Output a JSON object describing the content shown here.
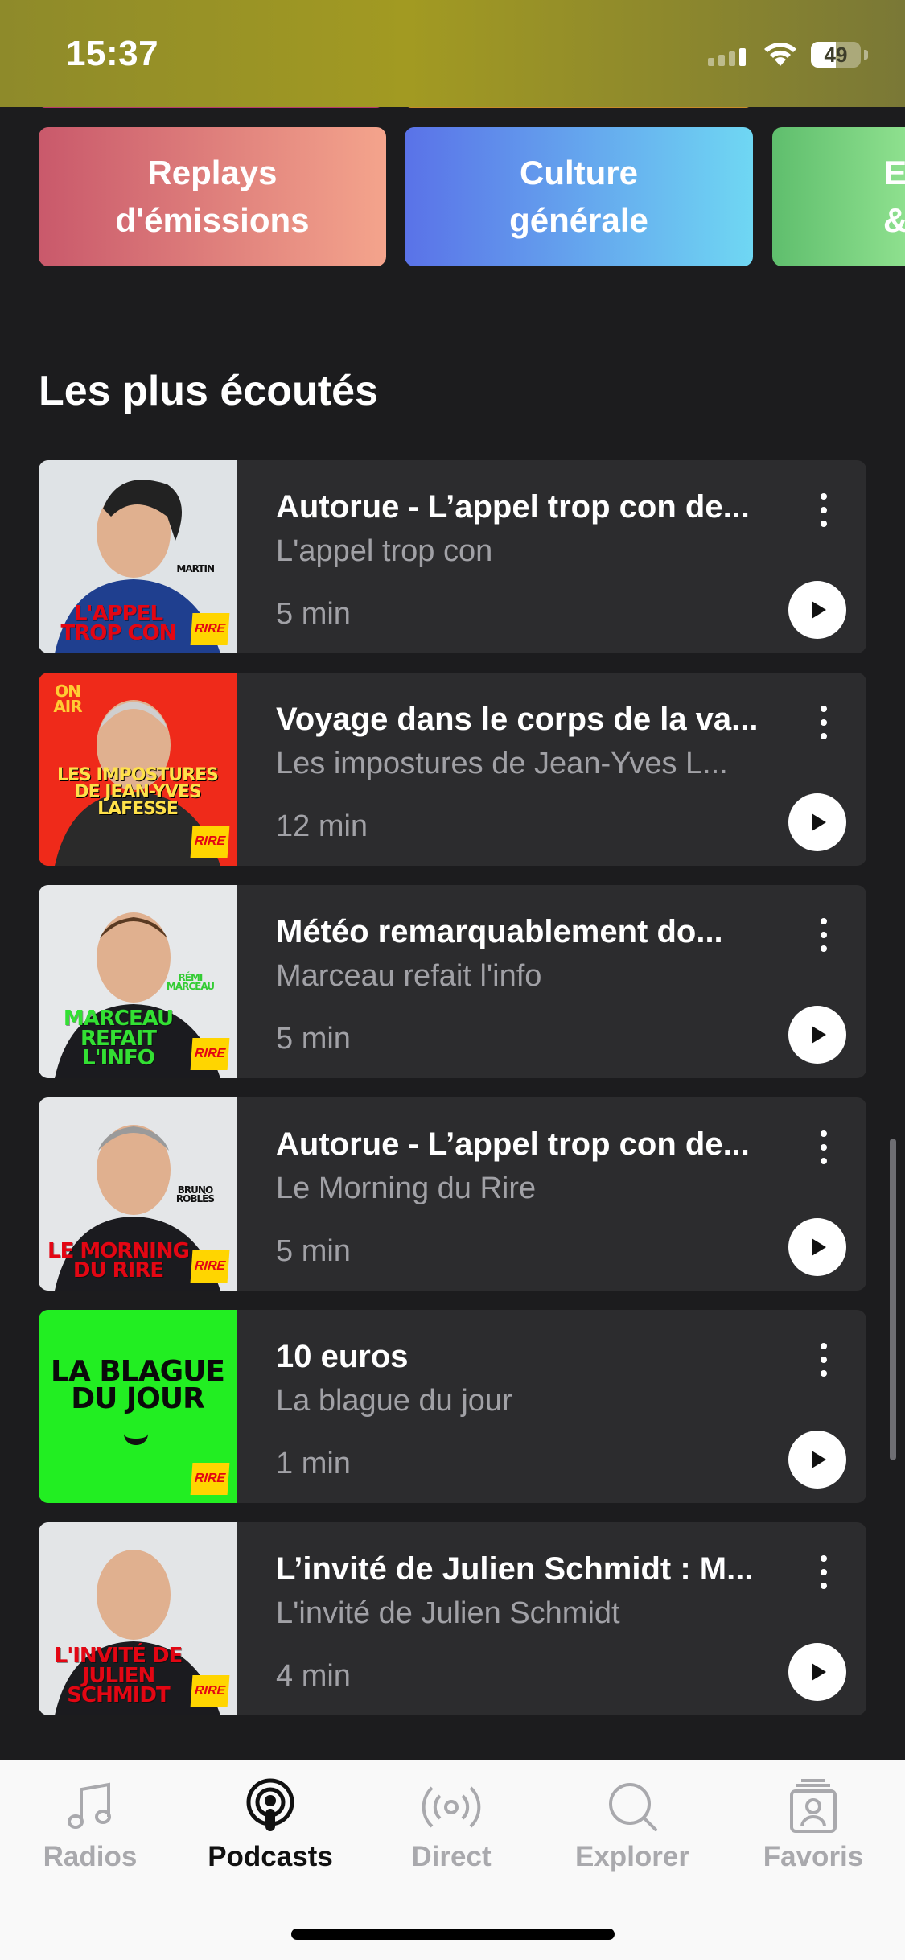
{
  "status_bar": {
    "time": "15:37",
    "battery": "49"
  },
  "categories": [
    {
      "label": "Replays\nd'émissions",
      "gradient": [
        "#c9596b",
        "#f4a48c"
      ]
    },
    {
      "label": "Culture\ngénérale",
      "gradient": [
        "#5a72e8",
        "#6fd7f3"
      ]
    },
    {
      "label": "E\n&",
      "gradient": [
        "#5fbe6d",
        "#8ee08e"
      ]
    }
  ],
  "section_title": "Les plus écoutés",
  "podcasts": [
    {
      "title": "Autorue - L’appel trop con de...",
      "show": "L'appel trop con",
      "duration": "5 min",
      "thumb_text": "L'APPEL\nTROP CON",
      "thumb_small": "MARTIN",
      "thumb_bg": "#dfe3e6",
      "thumb_text_color": "#e30613"
    },
    {
      "title": "Voyage dans le corps de la va...",
      "show": "Les impostures de Jean-Yves L...",
      "duration": "12 min",
      "thumb_text": "LES IMPOSTURES\nDE JEAN-YVES\nLAFESSE",
      "thumb_small": "ON AIR",
      "thumb_bg": "#ef2a1a",
      "thumb_text_color": "#ffe14a"
    },
    {
      "title": "Météo remarquablement do...",
      "show": "Marceau refait l'info",
      "duration": "5 min",
      "thumb_text": "MARCEAU\nREFAIT L'INFO",
      "thumb_small": "RÉMI\nMARCEAU",
      "thumb_bg": "#e6e8ea",
      "thumb_text_color": "#33e033"
    },
    {
      "title": "Autorue - L’appel trop con de...",
      "show": "Le Morning du Rire",
      "duration": "5 min",
      "thumb_text": "LE MORNING\nDU RIRE",
      "thumb_small": "BRUNO\nROBLÈS",
      "thumb_bg": "#e4e6e8",
      "thumb_text_color": "#e30613"
    },
    {
      "title": "10 euros",
      "show": "La blague du jour",
      "duration": "1 min",
      "thumb_text": "LA BLAGUE\nDU JOUR",
      "thumb_small": "",
      "thumb_bg": "#22ee22",
      "thumb_text_color": "#0a0a0a"
    },
    {
      "title": "L’invité de Julien Schmidt : M...",
      "show": "L'invité de Julien Schmidt",
      "duration": "4 min",
      "thumb_text": "L'INVITÉ DE\nJULIEN SCHMIDT",
      "thumb_small": "",
      "thumb_bg": "#e3e5e7",
      "thumb_text_color": "#e30613"
    }
  ],
  "rire_badge": "RIRE",
  "tabs": [
    {
      "label": "Radios",
      "icon": "music-note-icon",
      "active": false
    },
    {
      "label": "Podcasts",
      "icon": "podcast-icon",
      "active": true
    },
    {
      "label": "Direct",
      "icon": "broadcast-icon",
      "active": false
    },
    {
      "label": "Explorer",
      "icon": "search-icon",
      "active": false
    },
    {
      "label": "Favoris",
      "icon": "favorites-icon",
      "active": false
    }
  ]
}
